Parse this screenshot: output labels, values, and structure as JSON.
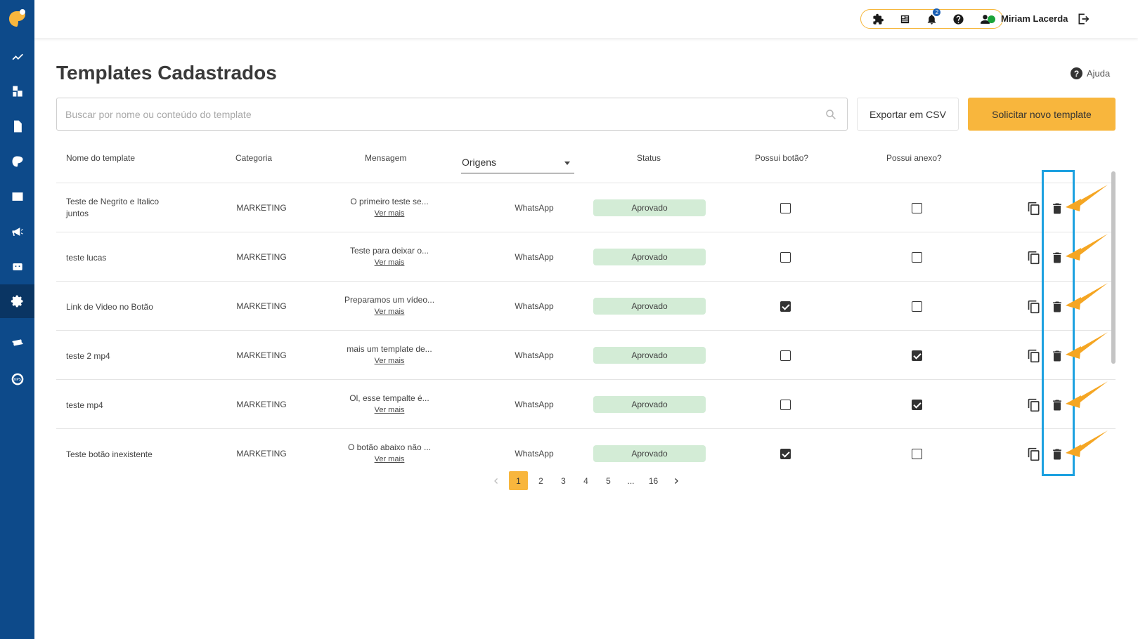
{
  "header": {
    "user_name": "Miriam Lacerda",
    "notification_count": "2",
    "status_color": "#1aa33a"
  },
  "page": {
    "title": "Templates Cadastrados",
    "help_label": "Ajuda",
    "search_placeholder": "Buscar por nome ou conteúdo do template",
    "export_label": "Exportar em CSV",
    "new_label": "Solicitar novo template"
  },
  "table": {
    "headers": {
      "name": "Nome do template",
      "category": "Categoria",
      "message": "Mensagem",
      "origins": "Origens",
      "status": "Status",
      "has_button": "Possui botão?",
      "has_attachment": "Possui anexo?"
    },
    "see_more": "Ver mais",
    "rows": [
      {
        "name": "Teste de Negrito e Italico juntos",
        "category": "MARKETING",
        "message": "O primeiro teste se...",
        "origin": "WhatsApp",
        "status": "Aprovado",
        "has_button": false,
        "has_attachment": false
      },
      {
        "name": "teste lucas",
        "category": "MARKETING",
        "message": "Teste para deixar o...",
        "origin": "WhatsApp",
        "status": "Aprovado",
        "has_button": false,
        "has_attachment": false
      },
      {
        "name": "Link de Video no Botão",
        "category": "MARKETING",
        "message": "Preparamos um vídeo...",
        "origin": "WhatsApp",
        "status": "Aprovado",
        "has_button": true,
        "has_attachment": false
      },
      {
        "name": "teste 2 mp4",
        "category": "MARKETING",
        "message": "mais um template de...",
        "origin": "WhatsApp",
        "status": "Aprovado",
        "has_button": false,
        "has_attachment": true
      },
      {
        "name": "teste mp4",
        "category": "MARKETING",
        "message": "Ol, esse tempalte é...",
        "origin": "WhatsApp",
        "status": "Aprovado",
        "has_button": false,
        "has_attachment": true
      },
      {
        "name": "Teste botão inexistente",
        "category": "MARKETING",
        "message": "O botão abaixo não ...",
        "origin": "WhatsApp",
        "status": "Aprovado",
        "has_button": true,
        "has_attachment": false
      }
    ]
  },
  "pagination": {
    "pages": [
      "1",
      "2",
      "3",
      "4",
      "5",
      "...",
      "16"
    ],
    "current": "1"
  },
  "colors": {
    "sidebar": "#0d4a8a",
    "accent": "#f8b63d",
    "approved_bg": "#d3ecd6",
    "highlight": "#1da1e0",
    "annotation_arrow": "#f5a623"
  }
}
